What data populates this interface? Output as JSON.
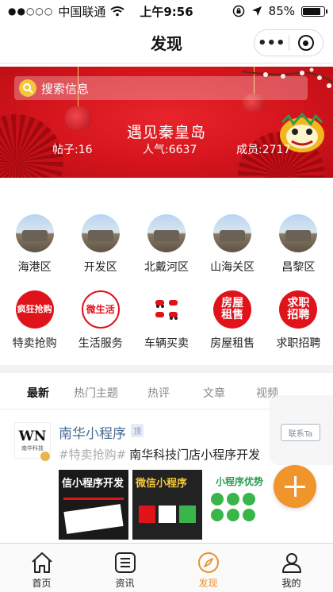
{
  "status_bar": {
    "signal": "●●○○○",
    "carrier": "中国联通",
    "time": "上午9:56",
    "battery_percent": "85%",
    "battery_level": 0.85
  },
  "nav": {
    "title": "发现",
    "more_label": "•••"
  },
  "banner": {
    "search_placeholder": "搜索信息",
    "title": "遇见秦皇岛",
    "posts_label": "帖子:16",
    "popularity_label": "人气:6637",
    "members_label": "成员:2717",
    "primary_color": "#d4141c"
  },
  "districts": [
    {
      "label": "海港区",
      "icon": "haigang-photo-icon"
    },
    {
      "label": "开发区",
      "icon": "kaifa-photo-icon"
    },
    {
      "label": "北戴河区",
      "icon": "beidaihe-photo-icon"
    },
    {
      "label": "山海关区",
      "icon": "shanhaiguan-photo-icon"
    },
    {
      "label": "昌黎区",
      "icon": "changli-photo-icon"
    }
  ],
  "services": [
    {
      "label": "特卖抢购",
      "badge": "疯狂抢购",
      "icon": "sale-icon"
    },
    {
      "label": "生活服务",
      "badge": "微生活",
      "icon": "life-service-icon"
    },
    {
      "label": "车辆买卖",
      "badge": "",
      "icon": "car-icon"
    },
    {
      "label": "房屋租售",
      "badge": "房屋租售",
      "icon": "house-icon"
    },
    {
      "label": "求职招聘",
      "badge": "求职招聘",
      "icon": "job-icon"
    }
  ],
  "tabs": [
    "最新",
    "热门主题",
    "热评",
    "文章",
    "视频"
  ],
  "post": {
    "author": "南华小程序",
    "top_badge": "顶",
    "contact_label": "联系Ta",
    "tag": "#特卖抢购#",
    "text": "南华科技门店小程序开发",
    "avatar_logo": "WN",
    "avatar_sub": "南华科技",
    "thumbs": [
      {
        "text": "信小程序开发",
        "icon": "thumb-dev-icon"
      },
      {
        "text": "微信小程序",
        "icon": "thumb-wechat-icon"
      },
      {
        "text": "小程序优势",
        "icon": "thumb-advantage-icon"
      }
    ]
  },
  "bottom_tabs": [
    {
      "label": "首页",
      "icon": "home-icon"
    },
    {
      "label": "资讯",
      "icon": "news-icon"
    },
    {
      "label": "发现",
      "icon": "compass-icon"
    },
    {
      "label": "我的",
      "icon": "user-icon"
    }
  ],
  "colors": {
    "accent": "#e8922c",
    "fab": "#f0952b",
    "link": "#4a6c96"
  }
}
